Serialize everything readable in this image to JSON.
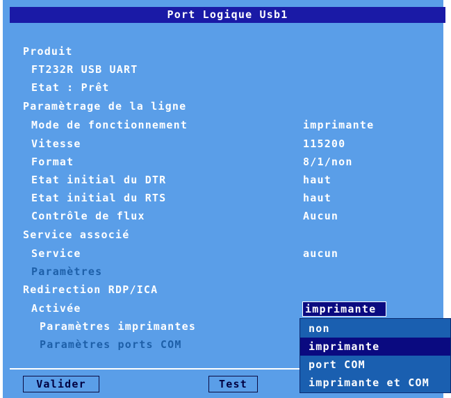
{
  "window": {
    "title": "Port Logique Usb1"
  },
  "produit": {
    "header": "Produit",
    "device": "FT232R USB UART",
    "etat": "Etat : Prêt"
  },
  "ligne": {
    "header": "Paramètrage de la ligne",
    "rows": [
      {
        "label": "Mode de fonctionnement",
        "value": "imprimante"
      },
      {
        "label": "Vitesse",
        "value": "115200"
      },
      {
        "label": "Format",
        "value": "8/1/non"
      },
      {
        "label": "Etat initial du DTR",
        "value": "haut"
      },
      {
        "label": "Etat initial du RTS",
        "value": "haut"
      },
      {
        "label": "Contrôle de flux",
        "value": "Aucun"
      }
    ]
  },
  "service": {
    "header": "Service associé",
    "label": "Service",
    "value": "aucun",
    "params": "Paramètres"
  },
  "redirection": {
    "header": "Redirection RDP/ICA",
    "activee_label": "Activée",
    "activee_value": "imprimante",
    "params_imprimantes": "Paramètres imprimantes",
    "params_com": "Paramètres ports COM"
  },
  "dropdown": {
    "options": [
      "non",
      "imprimante",
      "port COM",
      "imprimante et COM"
    ],
    "highlighted_index": 1
  },
  "buttons": {
    "valider": "Valider",
    "test": "Test"
  }
}
